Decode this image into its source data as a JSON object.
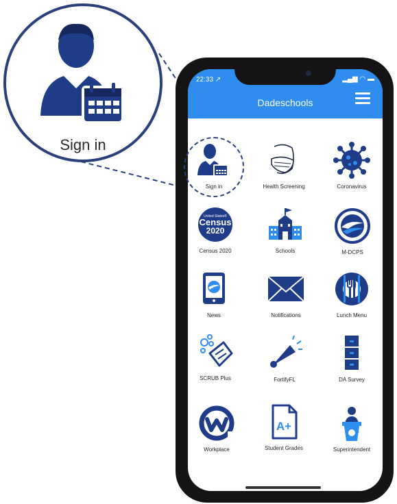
{
  "zoom": {
    "label": "Sign in",
    "icon": "user-calendar-icon"
  },
  "status": {
    "time": "22:33 ↗",
    "icons": "▂▄▆ ◠ ▬"
  },
  "header": {
    "title": "Dadeschools",
    "menu_icon": "hamburger-menu-icon"
  },
  "colors": {
    "accent": "#2f8df0",
    "icon_navy": "#1f3c88",
    "icon_blue": "#2f8df0"
  },
  "apps": [
    {
      "label": "Sign in",
      "icon": "user-calendar-icon"
    },
    {
      "label": "Health Screening",
      "icon": "face-mask-icon"
    },
    {
      "label": "Coronavirus",
      "icon": "virus-icon"
    },
    {
      "label": "Census 2020",
      "icon": "census-badge-icon",
      "badge_small": "United States®",
      "badge_big": "Census",
      "badge_year": "2020"
    },
    {
      "label": "Schools",
      "icon": "school-building-icon"
    },
    {
      "label": "M-DCPS",
      "icon": "mdcps-logo-icon"
    },
    {
      "label": "News",
      "icon": "tablet-news-icon"
    },
    {
      "label": "Notifications",
      "icon": "envelope-icon"
    },
    {
      "label": "Lunch Menu",
      "icon": "fork-knife-icon"
    },
    {
      "label": "SCRUB Plus",
      "icon": "scrub-bubbles-icon"
    },
    {
      "label": "FortifyFL",
      "icon": "megaphone-icon"
    },
    {
      "label": "DA Survey",
      "icon": "filing-cabinet-icon"
    },
    {
      "label": "Workplace",
      "icon": "workplace-logo-icon"
    },
    {
      "label": "Student Grades",
      "icon": "grade-a-plus-icon",
      "grade": "A+"
    },
    {
      "label": "Superintendent",
      "icon": "podium-speaker-icon"
    }
  ]
}
